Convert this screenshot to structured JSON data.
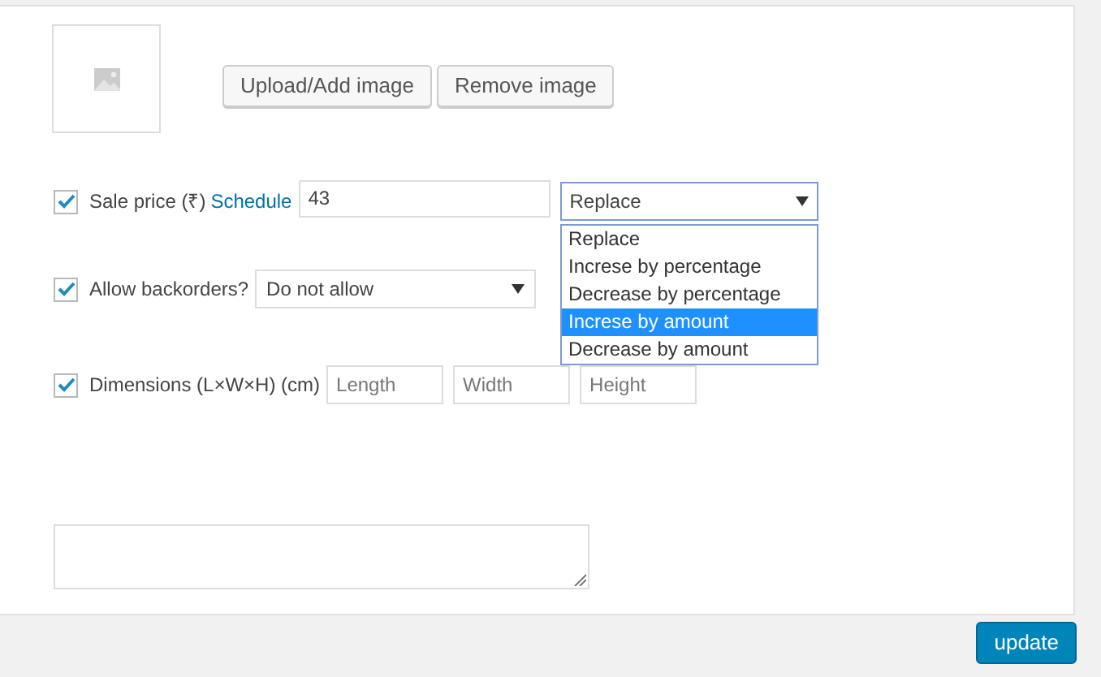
{
  "image_buttons": [
    "Upload/Add image",
    "Remove image"
  ],
  "sale_price": {
    "checked": true,
    "label": "Sale price (₹)",
    "link": "Schedule",
    "value": "43",
    "select": "Replace",
    "options": [
      {
        "label": "Replace",
        "selected": false
      },
      {
        "label": "Increse by percentage",
        "selected": false
      },
      {
        "label": "Decrease by percentage",
        "selected": false
      },
      {
        "label": "Increse by amount",
        "selected": true
      },
      {
        "label": "Decrease by amount",
        "selected": false
      }
    ]
  },
  "backorders": {
    "checked": true,
    "label": "Allow backorders?",
    "select": "Do not allow"
  },
  "dimensions": {
    "checked": true,
    "label": "Dimensions (L×W×H) (cm)",
    "placeholders": [
      "Length",
      "Width",
      "Height"
    ]
  },
  "update_button": "update"
}
